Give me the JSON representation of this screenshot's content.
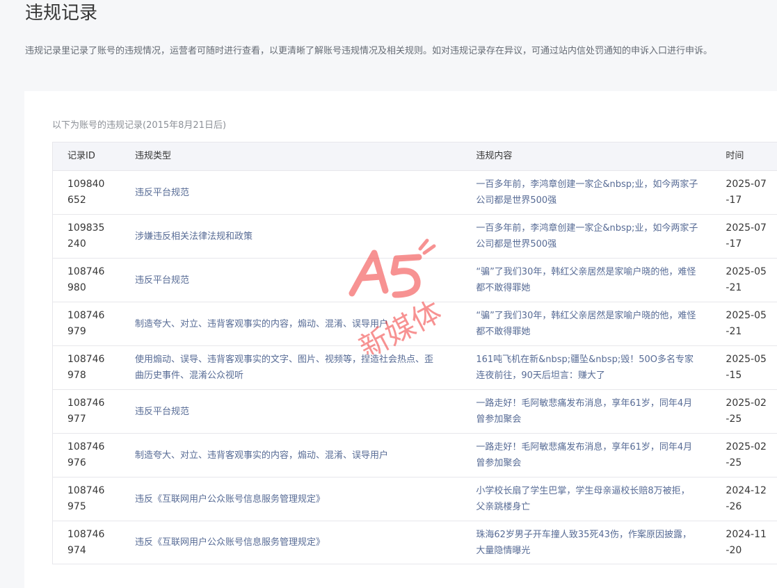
{
  "page": {
    "title": "违规记录",
    "description": "违规记录里记录了账号的违规情况，运营者可随时进行查看，以更清晰了解账号违规情况及相关规则。如对违规记录存在异议，可通过站内信处罚通知的申诉入口进行申诉。"
  },
  "records": {
    "caption": "以下为账号的违规记录(2015年8月21日后)",
    "columns": [
      "记录ID",
      "违规类型",
      "违规内容",
      "时间"
    ],
    "rows": [
      {
        "id_line1": "109840",
        "id_line2": "652",
        "type": "违反平台规范",
        "content": "一百多年前，李鸿章创建一家企&nbsp;业，如今两家子公司都是世界500强",
        "time_line1": "2025-07",
        "time_line2": "-17"
      },
      {
        "id_line1": "109835",
        "id_line2": "240",
        "type": "涉嫌违反相关法律法规和政策",
        "content": "一百多年前，李鸿章创建一家企&nbsp;业，如今两家子公司都是世界500强",
        "time_line1": "2025-07",
        "time_line2": "-17"
      },
      {
        "id_line1": "108746",
        "id_line2": "980",
        "type": "违反平台规范",
        "content": "“骗”了我们30年，韩红父亲居然是家喻户晓的他，难怪都不敢得罪她",
        "time_line1": "2025-05",
        "time_line2": "-21"
      },
      {
        "id_line1": "108746",
        "id_line2": "979",
        "type": "制造夸大、对立、违背客观事实的内容，煽动、混淆、误导用户",
        "content": "“骗”了我们30年，韩红父亲居然是家喻户晓的他，难怪都不敢得罪她",
        "time_line1": "2025-05",
        "time_line2": "-21"
      },
      {
        "id_line1": "108746",
        "id_line2": "978",
        "type": "使用煽动、误导、违背客观事实的文字、图片、视频等，捏造社会热点、歪曲历史事件、混淆公众视听",
        "content": "161吨飞机在新&nbsp;疆坠&nbsp;毁！50O多名专家连夜前往，90天后坦言：赚大了",
        "time_line1": "2025-05",
        "time_line2": "-15"
      },
      {
        "id_line1": "108746",
        "id_line2": "977",
        "type": "违反平台规范",
        "content": "一路走好！毛阿敏悲痛发布消息，享年61岁，同年4月曾参加聚会",
        "time_line1": "2025-02",
        "time_line2": "-25"
      },
      {
        "id_line1": "108746",
        "id_line2": "976",
        "type": "制造夸大、对立、违背客观事实的内容，煽动、混淆、误导用户",
        "content": "一路走好！毛阿敏悲痛发布消息，享年61岁，同年4月曾参加聚会",
        "time_line1": "2025-02",
        "time_line2": "-25"
      },
      {
        "id_line1": "108746",
        "id_line2": "975",
        "type": "违反《互联网用户公众账号信息服务管理规定》",
        "content": "小学校长扇了学生巴掌，学生母亲逼校长赔8万被拒，父亲跳楼身亡",
        "time_line1": "2024-12",
        "time_line2": "-26"
      },
      {
        "id_line1": "108746",
        "id_line2": "974",
        "type": "违反《互联网用户公众账号信息服务管理规定》",
        "content": "珠海62岁男子开车撞人致35死43伤，作案原因披露，大量隐情曝光",
        "time_line1": "2024-11",
        "time_line2": "-20"
      }
    ]
  },
  "watermark": {
    "logo_text": "A5",
    "brand_text": "新媒体",
    "color": "#f23a3a"
  },
  "colors": {
    "background": "#f6f7f9",
    "card": "#ffffff",
    "header_row": "#f4f5f9",
    "link_text": "#576b95",
    "border": "#e7e7eb"
  }
}
